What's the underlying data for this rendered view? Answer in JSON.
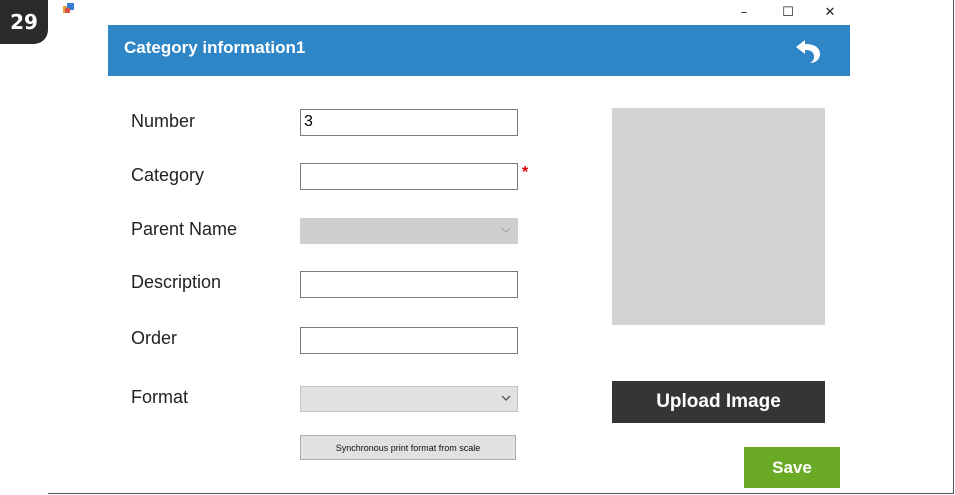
{
  "badge_number": "29",
  "window": {
    "icon": "app-icon",
    "minimize_glyph": "–",
    "maximize_glyph": "☐",
    "close_glyph": "✕"
  },
  "header": {
    "title": "Category information1",
    "back_icon": "undo-arrow-icon",
    "color": "#2f86c6"
  },
  "form": {
    "number_label": "Number",
    "number_value": "3",
    "category_label": "Category",
    "category_value": "",
    "required_marker": "*",
    "parent_name_label": "Parent Name",
    "parent_name_value": "",
    "description_label": "Description",
    "description_value": "",
    "order_label": "Order",
    "order_value": "",
    "format_label": "Format",
    "format_value": "",
    "sync_button_label": "Synchronous print format from scale"
  },
  "image_panel": {
    "upload_button_label": "Upload Image"
  },
  "save_button_label": "Save",
  "colors": {
    "save": "#6aaa25",
    "upload": "#353535",
    "required": "#e00000"
  }
}
